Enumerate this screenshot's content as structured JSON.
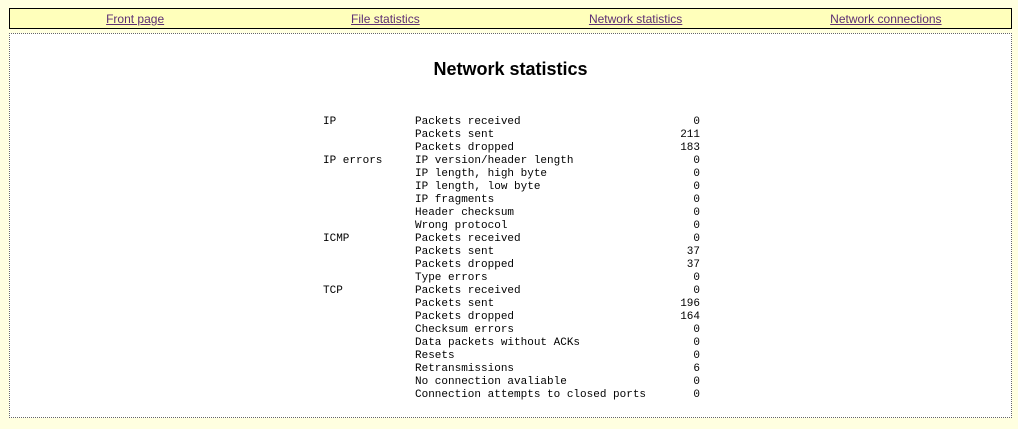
{
  "menu": {
    "front_page": "Front page",
    "file_statistics": "File statistics",
    "network_statistics": "Network statistics",
    "network_connections": "Network connections"
  },
  "page": {
    "title": "Network statistics"
  },
  "stats": {
    "rows": [
      {
        "category": "IP",
        "label": "Packets received",
        "value": "0"
      },
      {
        "category": "",
        "label": "Packets sent",
        "value": "211"
      },
      {
        "category": "",
        "label": "Packets dropped",
        "value": "183"
      },
      {
        "category": "IP errors",
        "label": "IP version/header length",
        "value": "0"
      },
      {
        "category": "",
        "label": "IP length, high byte",
        "value": "0"
      },
      {
        "category": "",
        "label": "IP length, low byte",
        "value": "0"
      },
      {
        "category": "",
        "label": "IP fragments",
        "value": "0"
      },
      {
        "category": "",
        "label": "Header checksum",
        "value": "0"
      },
      {
        "category": "",
        "label": "Wrong protocol",
        "value": "0"
      },
      {
        "category": "ICMP",
        "label": "Packets received",
        "value": "0"
      },
      {
        "category": "",
        "label": "Packets sent",
        "value": "37"
      },
      {
        "category": "",
        "label": "Packets dropped",
        "value": "37"
      },
      {
        "category": "",
        "label": "Type errors",
        "value": "0"
      },
      {
        "category": "TCP",
        "label": "Packets received",
        "value": "0"
      },
      {
        "category": "",
        "label": "Packets sent",
        "value": "196"
      },
      {
        "category": "",
        "label": "Packets dropped",
        "value": "164"
      },
      {
        "category": "",
        "label": "Checksum errors",
        "value": "0"
      },
      {
        "category": "",
        "label": "Data packets without ACKs",
        "value": "0"
      },
      {
        "category": "",
        "label": "Resets",
        "value": "0"
      },
      {
        "category": "",
        "label": "Retransmissions",
        "value": "6"
      },
      {
        "category": "",
        "label": "No connection avaliable",
        "value": "0"
      },
      {
        "category": "",
        "label": "Connection attempts to closed ports",
        "value": "0"
      }
    ]
  },
  "colors": {
    "page_background": "#ffffe0",
    "menu_background": "#ffffbb",
    "link": "#5d2f74"
  }
}
